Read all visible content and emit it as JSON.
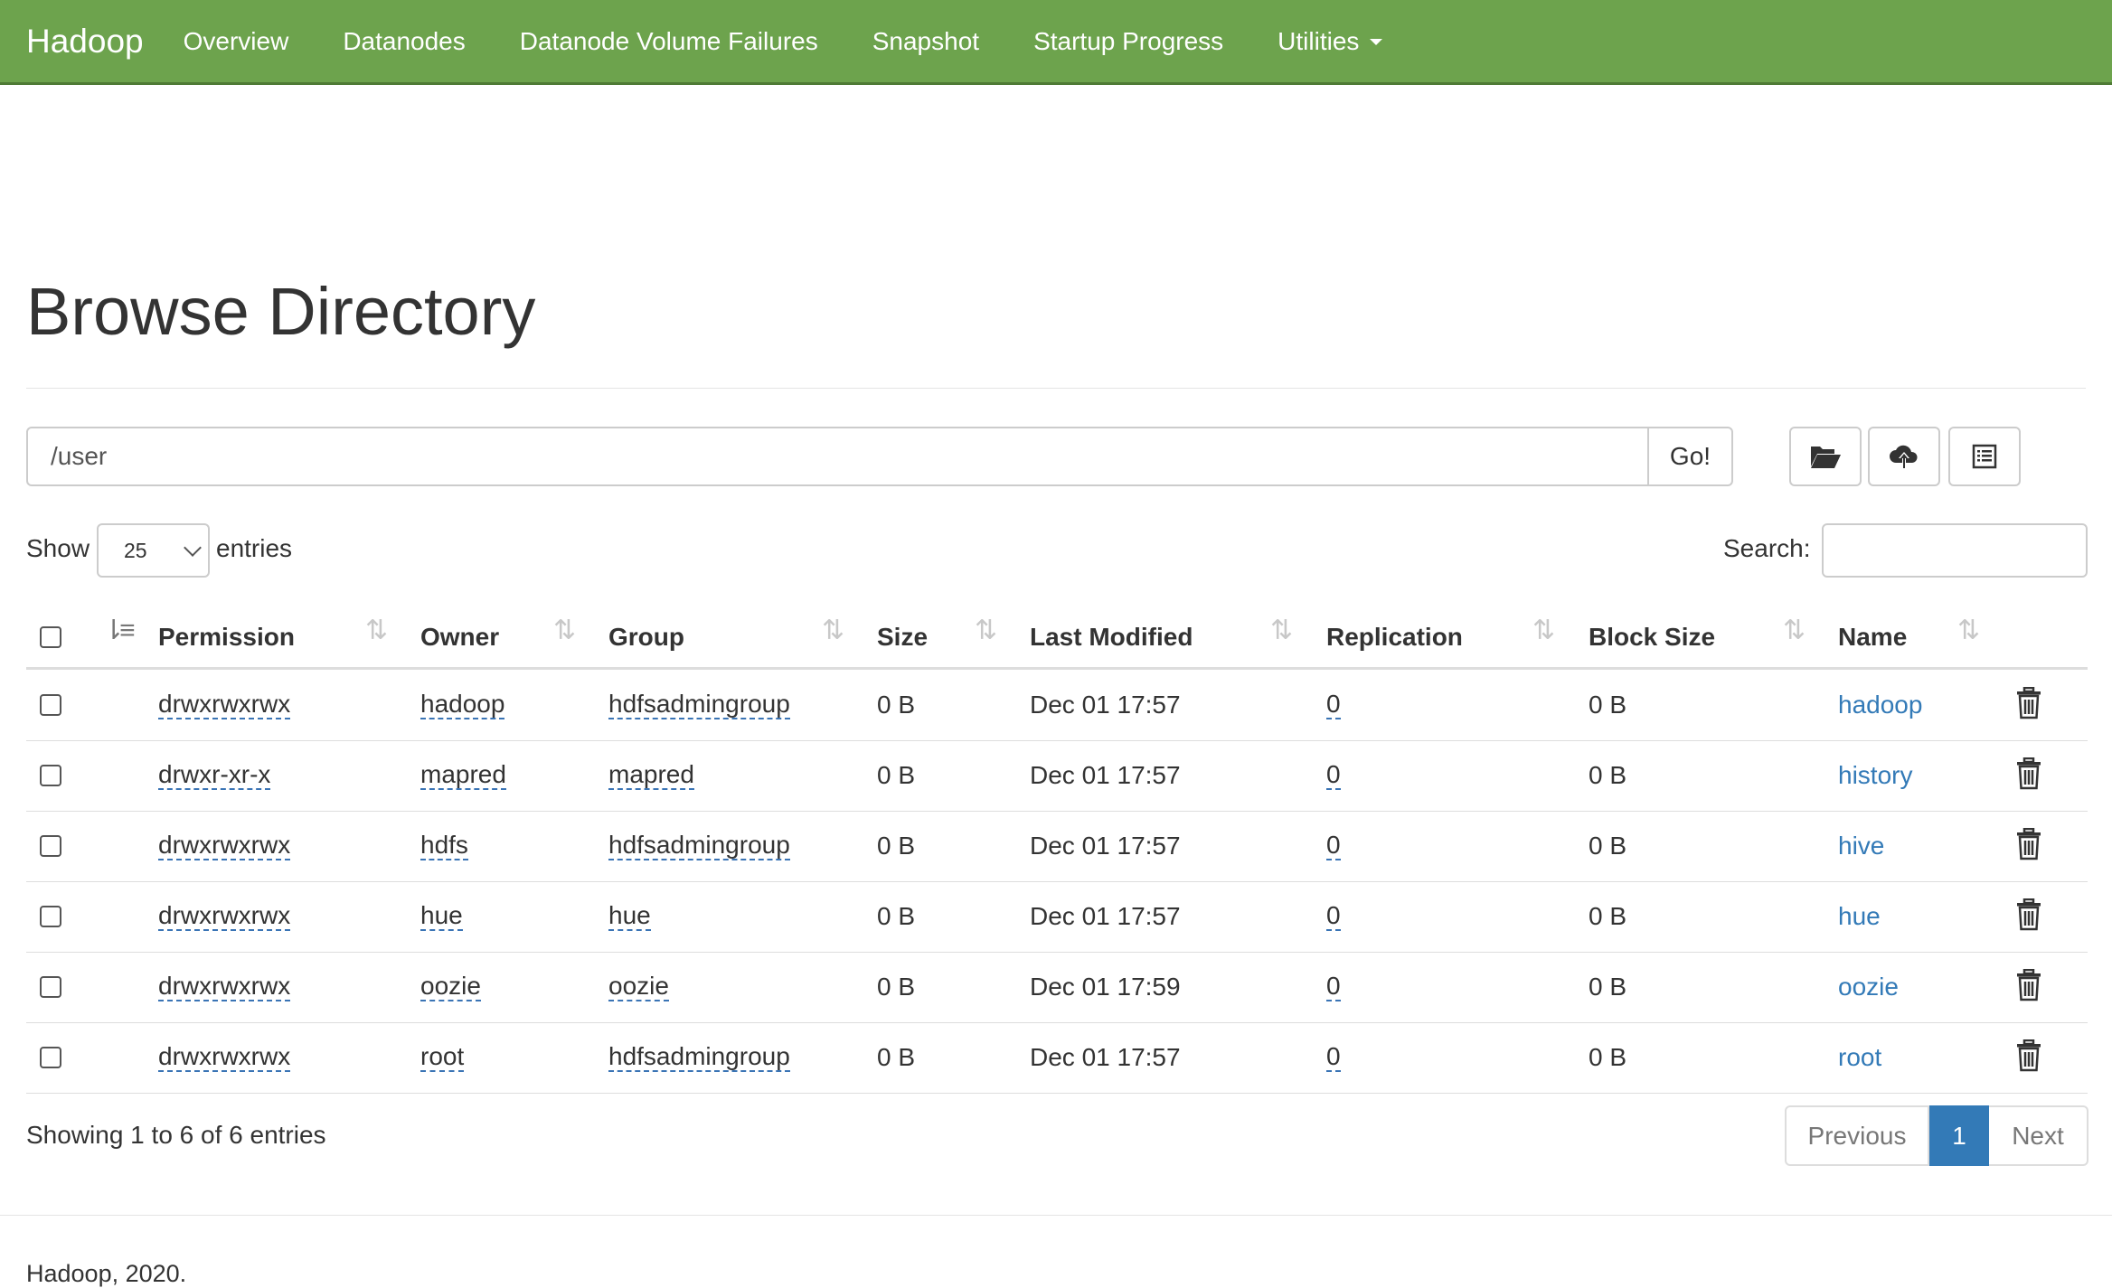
{
  "navbar": {
    "brand": "Hadoop",
    "items": [
      {
        "label": "Overview"
      },
      {
        "label": "Datanodes"
      },
      {
        "label": "Datanode Volume Failures"
      },
      {
        "label": "Snapshot"
      },
      {
        "label": "Startup Progress"
      },
      {
        "label": "Utilities"
      }
    ],
    "background_color": "#6da34d"
  },
  "page": {
    "title": "Browse Directory"
  },
  "path_bar": {
    "value": "/user",
    "go_label": "Go!",
    "buttons": [
      "folder-open-icon",
      "cloud-upload-icon",
      "list-icon"
    ]
  },
  "table_controls": {
    "show_label": "Show",
    "page_length": "25",
    "entries_label": "entries",
    "search_label": "Search:"
  },
  "table": {
    "columns": [
      "Permission",
      "Owner",
      "Group",
      "Size",
      "Last Modified",
      "Replication",
      "Block Size",
      "Name"
    ],
    "rows": [
      {
        "permission": "drwxrwxrwx",
        "owner": "hadoop",
        "group": "hdfsadmingroup",
        "size": "0 B",
        "modified": "Dec 01 17:57",
        "replication": "0",
        "block_size": "0 B",
        "name": "hadoop"
      },
      {
        "permission": "drwxr-xr-x",
        "owner": "mapred",
        "group": "mapred",
        "size": "0 B",
        "modified": "Dec 01 17:57",
        "replication": "0",
        "block_size": "0 B",
        "name": "history"
      },
      {
        "permission": "drwxrwxrwx",
        "owner": "hdfs",
        "group": "hdfsadmingroup",
        "size": "0 B",
        "modified": "Dec 01 17:57",
        "replication": "0",
        "block_size": "0 B",
        "name": "hive"
      },
      {
        "permission": "drwxrwxrwx",
        "owner": "hue",
        "group": "hue",
        "size": "0 B",
        "modified": "Dec 01 17:57",
        "replication": "0",
        "block_size": "0 B",
        "name": "hue"
      },
      {
        "permission": "drwxrwxrwx",
        "owner": "oozie",
        "group": "oozie",
        "size": "0 B",
        "modified": "Dec 01 17:59",
        "replication": "0",
        "block_size": "0 B",
        "name": "oozie"
      },
      {
        "permission": "drwxrwxrwx",
        "owner": "root",
        "group": "hdfsadmingroup",
        "size": "0 B",
        "modified": "Dec 01 17:57",
        "replication": "0",
        "block_size": "0 B",
        "name": "root"
      }
    ]
  },
  "pagination": {
    "info": "Showing 1 to 6 of 6 entries",
    "previous": "Previous",
    "current": "1",
    "next": "Next"
  },
  "footer": {
    "copyright": "Hadoop, 2020."
  },
  "colors": {
    "link": "#337ab7",
    "pager_active": "#337ab7"
  }
}
